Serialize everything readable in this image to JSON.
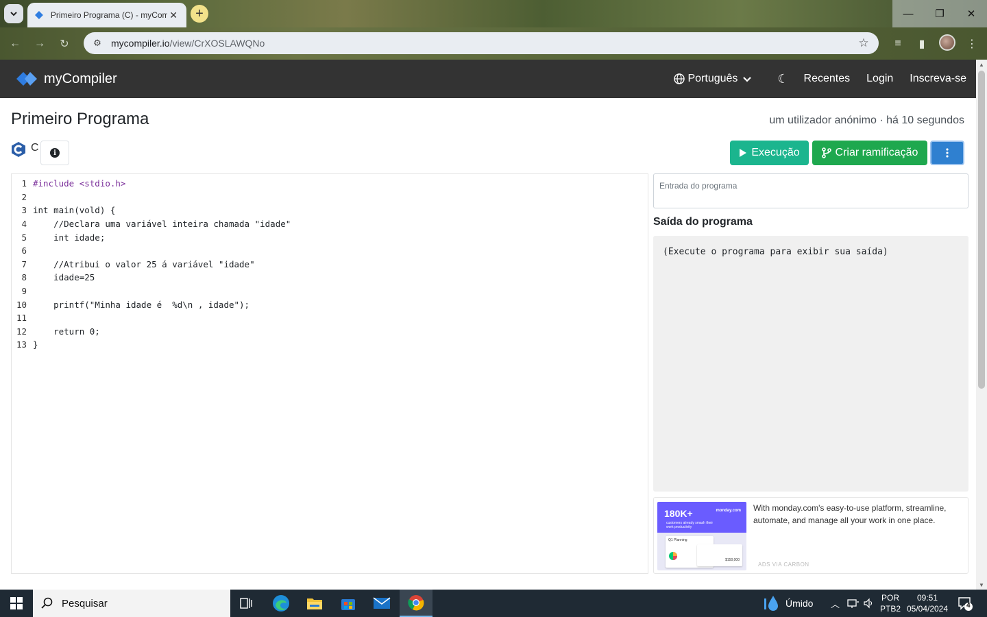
{
  "browser": {
    "tab_title": "Primeiro Programa (C) - myCompiler",
    "url_host": "mycompiler.io",
    "url_path": "/view/CrXOSLAWQNo"
  },
  "navbar": {
    "brand": "myCompiler",
    "language": "Português",
    "links": [
      "Recentes",
      "Login",
      "Inscreva-se"
    ]
  },
  "program": {
    "title": "Primeiro Programa",
    "meta": "um utilizador anónimo · há 10 segundos",
    "language_label": "C"
  },
  "actions": {
    "run_label": "Execução",
    "fork_label": "Criar ramificação"
  },
  "editor": {
    "lines": [
      {
        "n": "1",
        "text": "#include <stdio.h>"
      },
      {
        "n": "2",
        "text": ""
      },
      {
        "n": "3",
        "text": "int main(vold) {"
      },
      {
        "n": "4",
        "text": "    //Declara uma variável inteira chamada \"idade\""
      },
      {
        "n": "5",
        "text": "    int idade;"
      },
      {
        "n": "6",
        "text": ""
      },
      {
        "n": "7",
        "text": "    //Atribui o valor 25 á variável \"idade\""
      },
      {
        "n": "8",
        "text": "    idade=25"
      },
      {
        "n": "9",
        "text": ""
      },
      {
        "n": "10",
        "text": "    printf(\"Minha idade é  %d\\n , idade\");"
      },
      {
        "n": "11",
        "text": ""
      },
      {
        "n": "12",
        "text": "    return 0;"
      },
      {
        "n": "13",
        "text": "}"
      }
    ]
  },
  "io": {
    "input_placeholder": "Entrada do programa",
    "output_title": "Saída do programa",
    "output_text": "(Execute o programa para exibir sua saída)"
  },
  "ad": {
    "headline": "180K+",
    "sub": "customers already smash their work productivity",
    "brand": "monday.com",
    "card_title": "Q1 Planning",
    "card_value": "$150,000",
    "text": "With monday.com's easy-to-use platform, streamline, automate, and manage all your work in one place.",
    "via": "ADS VIA CARBON"
  },
  "taskbar": {
    "search_placeholder": "Pesquisar",
    "weather": "Úmido",
    "lang_top": "POR",
    "lang_bottom": "PTB2",
    "time": "09:51",
    "date": "05/04/2024",
    "notifications": "4"
  },
  "colors": {
    "run": "#1bb58e",
    "fork": "#1ea84e",
    "more": "#2f80d0",
    "navbar": "#333333",
    "brand_logo": "#2f7de1"
  }
}
